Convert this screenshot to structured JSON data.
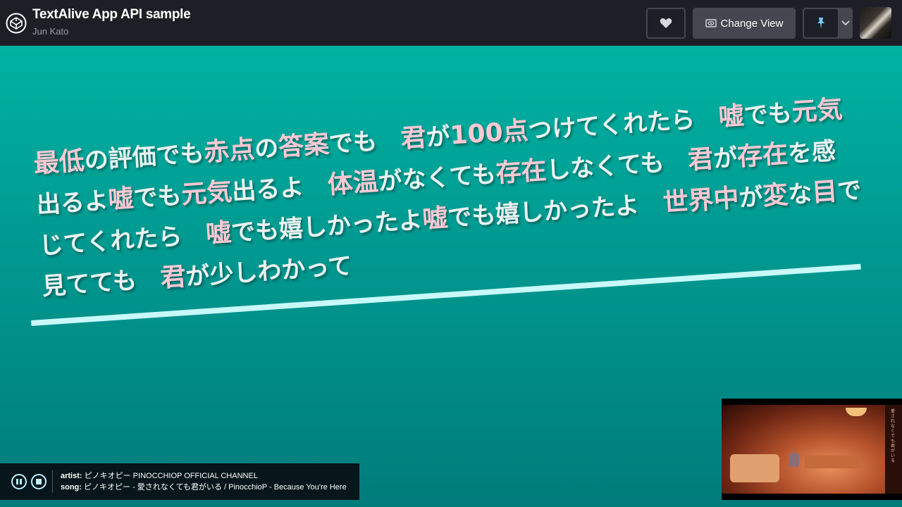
{
  "header": {
    "title": "TextAlive App API sample",
    "author": "Jun Kato",
    "change_view_label": "Change View"
  },
  "lyrics": {
    "lines": [
      [
        {
          "t": "最低",
          "k": true
        },
        {
          "t": "の",
          "k": false
        },
        {
          "t": "評価",
          "k": false
        },
        {
          "t": "でも",
          "k": false
        },
        {
          "t": "赤点",
          "k": true
        },
        {
          "t": "の",
          "k": false
        },
        {
          "t": "答案",
          "k": true
        },
        {
          "t": "でも",
          "k": false
        },
        {
          "t": "　",
          "k": false
        },
        {
          "t": "君",
          "k": true
        },
        {
          "t": "が",
          "k": false
        },
        {
          "t": "100点",
          "k": true
        },
        {
          "t": "つけてくれたら",
          "k": false
        },
        {
          "t": "　",
          "k": false
        },
        {
          "t": "嘘",
          "k": true
        },
        {
          "t": "でも",
          "k": false
        },
        {
          "t": "元気",
          "k": true
        }
      ],
      [
        {
          "t": "出るよ",
          "k": false
        },
        {
          "t": "嘘",
          "k": true
        },
        {
          "t": "でも",
          "k": false
        },
        {
          "t": "元気",
          "k": true
        },
        {
          "t": "出るよ",
          "k": false
        },
        {
          "t": "　",
          "k": false
        },
        {
          "t": "体温",
          "k": true
        },
        {
          "t": "がなくても",
          "k": false
        },
        {
          "t": "存在",
          "k": true
        },
        {
          "t": "しなくても",
          "k": false
        },
        {
          "t": "　",
          "k": false
        },
        {
          "t": "君",
          "k": true
        },
        {
          "t": "が",
          "k": false
        },
        {
          "t": "存在",
          "k": true
        },
        {
          "t": "を",
          "k": false
        },
        {
          "t": "感",
          "k": false
        }
      ],
      [
        {
          "t": "じてくれたら",
          "k": false
        },
        {
          "t": "　",
          "k": false
        },
        {
          "t": "嘘",
          "k": true
        },
        {
          "t": "でも",
          "k": false
        },
        {
          "t": "嬉",
          "k": false
        },
        {
          "t": "しかったよ",
          "k": false
        },
        {
          "t": "嘘",
          "k": true
        },
        {
          "t": "でも",
          "k": false
        },
        {
          "t": "嬉",
          "k": false
        },
        {
          "t": "しかったよ",
          "k": false
        },
        {
          "t": "　",
          "k": false
        },
        {
          "t": "世界中",
          "k": true
        },
        {
          "t": "が",
          "k": false
        },
        {
          "t": "変",
          "k": true
        },
        {
          "t": "な",
          "k": false
        },
        {
          "t": "目",
          "k": true
        },
        {
          "t": "で",
          "k": false
        }
      ],
      [
        {
          "t": "見てても",
          "k": false
        },
        {
          "t": "　",
          "k": false
        },
        {
          "t": "君",
          "k": true
        },
        {
          "t": "が",
          "k": false
        },
        {
          "t": "少",
          "k": false
        },
        {
          "t": "しわかって",
          "k": false
        }
      ]
    ]
  },
  "player": {
    "artist_label": "artist:",
    "artist_value": "ピノキオピー PINOCCHIOP OFFICIAL CHANNEL",
    "song_label": "song:",
    "song_value": "ピノキオピー - 愛されなくても君がいる / PinocchioP - Because You're Here"
  },
  "video": {
    "side_text": "愛されなくても君がいる"
  },
  "colors": {
    "header_bg": "#1e1f26",
    "stage_top": "#00b2a1",
    "stage_bottom": "#007c7b",
    "lyric_text": "#eaf2f0",
    "lyric_highlight": "#ffc8d3",
    "progress_bar": "#c8f8f8",
    "pin_accent": "#6fd0ff"
  },
  "icons": {
    "logo": "codepen-cube-icon",
    "heart": "heart-icon",
    "change_view": "eye-frame-icon",
    "pin": "pin-icon",
    "pin_menu": "chevron-down-icon",
    "pause": "pause-icon",
    "stop": "stop-icon"
  }
}
